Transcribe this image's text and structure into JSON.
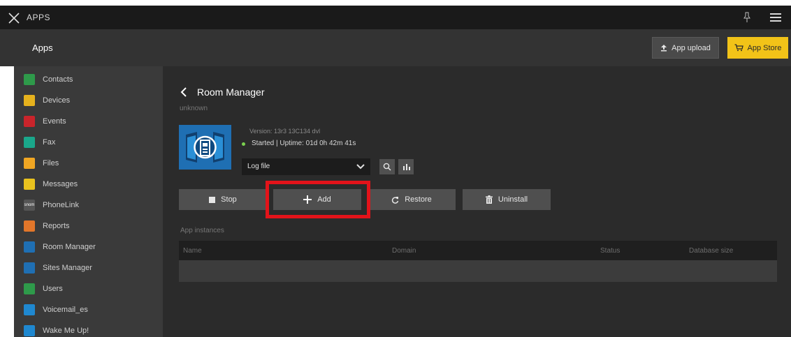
{
  "topbar": {
    "title": "APPS",
    "close_icon": "close-x-icon",
    "pin_icon": "pin-icon",
    "menu_icon": "hamburger-icon"
  },
  "subbar": {
    "title": "Apps",
    "upload_label": "App upload",
    "store_label": "App Store",
    "store_color": "#f2c318"
  },
  "sidebar": {
    "items": [
      {
        "label": "Contacts",
        "icon": "contacts-icon",
        "color": "#2e9a4a"
      },
      {
        "label": "Devices",
        "icon": "devices-icon",
        "color": "#e6b21d"
      },
      {
        "label": "Events",
        "icon": "events-icon",
        "color": "#c9242b"
      },
      {
        "label": "Fax",
        "icon": "fax-icon",
        "color": "#1aa78b"
      },
      {
        "label": "Files",
        "icon": "files-icon",
        "color": "#f0a623"
      },
      {
        "label": "Messages",
        "icon": "messages-icon",
        "color": "#e9c21e"
      },
      {
        "label": "PhoneLink",
        "icon": "phonelink-icon",
        "icon_text": "snom",
        "color": "#555555"
      },
      {
        "label": "Reports",
        "icon": "reports-icon",
        "color": "#e2762a"
      },
      {
        "label": "Room Manager",
        "icon": "room-manager-icon",
        "color": "#1f6fb3"
      },
      {
        "label": "Sites Manager",
        "icon": "sites-manager-icon",
        "color": "#1f6fb3"
      },
      {
        "label": "Users",
        "icon": "users-icon",
        "color": "#2e9a4a"
      },
      {
        "label": "Voicemail_es",
        "icon": "voicemail-icon",
        "color": "#1f88d0"
      },
      {
        "label": "Wake Me Up!",
        "icon": "wake-me-up-icon",
        "color": "#1f88d0"
      }
    ]
  },
  "main": {
    "title": "Room Manager",
    "subtitle": "unknown",
    "version": "Version: 13r3 13C134 dvl",
    "status": "Started | Uptime: 01d 0h 42m 41s",
    "status_color": "#7bd14f",
    "log_select": "Log file",
    "actions": {
      "stop": "Stop",
      "add": "Add",
      "restore": "Restore",
      "uninstall": "Uninstall"
    },
    "instances_label": "App instances",
    "columns": [
      "Name",
      "Domain",
      "Status",
      "Database size"
    ]
  }
}
